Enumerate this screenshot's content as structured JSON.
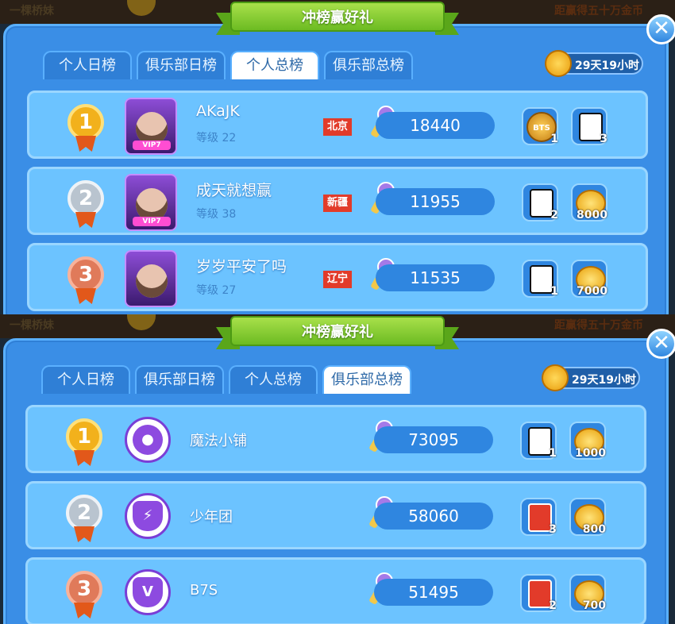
{
  "panels": [
    {
      "bg_left_text": "一棵桥妹",
      "bg_right_text": "距赢得五十万金币",
      "banner_title": "冲榜赢好礼",
      "close": "✕",
      "tabs": [
        "个人日榜",
        "俱乐部日榜",
        "个人总榜",
        "俱乐部总榜"
      ],
      "active_tab": 2,
      "timer": "29天19小时",
      "rows": [
        {
          "rank": "1",
          "name": "AKaJK",
          "level": "等级 22",
          "region": "北京",
          "score": "18440",
          "rewards": [
            {
              "type": "badge",
              "label": "BTS",
              "count": "1"
            },
            {
              "type": "card",
              "count": "3"
            }
          ]
        },
        {
          "rank": "2",
          "name": "成天就想赢",
          "level": "等级 38",
          "region": "新疆",
          "score": "11955",
          "rewards": [
            {
              "type": "card",
              "count": "2"
            },
            {
              "type": "coin",
              "count": "8000"
            }
          ]
        },
        {
          "rank": "3",
          "name": "岁岁平安了吗",
          "level": "等级 27",
          "region": "辽宁",
          "score": "11535",
          "rewards": [
            {
              "type": "card",
              "count": "1"
            },
            {
              "type": "coin",
              "count": "7000"
            }
          ]
        }
      ]
    },
    {
      "bg_left_text": "一棵桥妹",
      "bg_right_text": "距赢得五十万金币",
      "banner_title": "冲榜赢好礼",
      "close": "✕",
      "tabs": [
        "个人日榜",
        "俱乐部日榜",
        "个人总榜",
        "俱乐部总榜"
      ],
      "active_tab": 3,
      "timer": "29天19小时",
      "rows": [
        {
          "rank": "1",
          "name": "魔法小铺",
          "icon": "●",
          "score": "73095",
          "rewards": [
            {
              "type": "card",
              "count": "1"
            },
            {
              "type": "coin",
              "count": "1000"
            }
          ]
        },
        {
          "rank": "2",
          "name": "少年团",
          "icon": "⚡",
          "score": "58060",
          "rewards": [
            {
              "type": "card-red",
              "count": "3"
            },
            {
              "type": "coin",
              "count": "800"
            }
          ]
        },
        {
          "rank": "3",
          "name": "B7S",
          "icon": "V",
          "score": "51495",
          "rewards": [
            {
              "type": "card-red",
              "count": "2"
            },
            {
              "type": "coin",
              "count": "700"
            }
          ]
        }
      ]
    }
  ],
  "colors": {
    "frame": "#3a8ee6",
    "row": "#6cc3ff",
    "banner": "#8ccf34",
    "region": "#e23b2a"
  }
}
